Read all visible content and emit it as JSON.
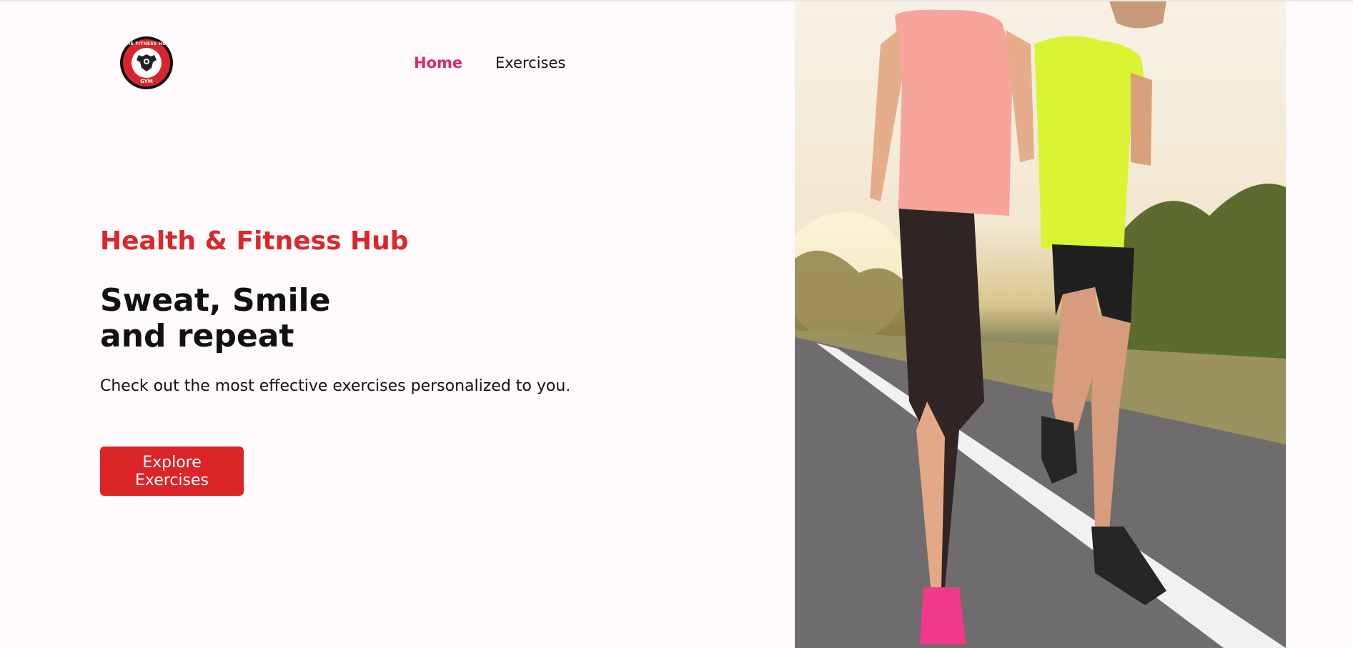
{
  "nav": {
    "logo": {
      "brand_text": "THE FITNESS HUB",
      "sub_text": "GYM"
    },
    "links": [
      {
        "label": "Home",
        "active": true
      },
      {
        "label": "Exercises",
        "active": false
      }
    ]
  },
  "hero": {
    "tagline": "Health & Fitness Hub",
    "headline_line1": "Sweat, Smile",
    "headline_line2": "and repeat",
    "subtext": "Check out the most effective exercises personalized to you.",
    "cta_label": "Explore Exercises",
    "image_subject": "two-runners-photo"
  },
  "colors": {
    "brand_red": "#d9272b",
    "nav_active": "#e0246a",
    "background": "#fffafb",
    "button": "#dc2528"
  }
}
